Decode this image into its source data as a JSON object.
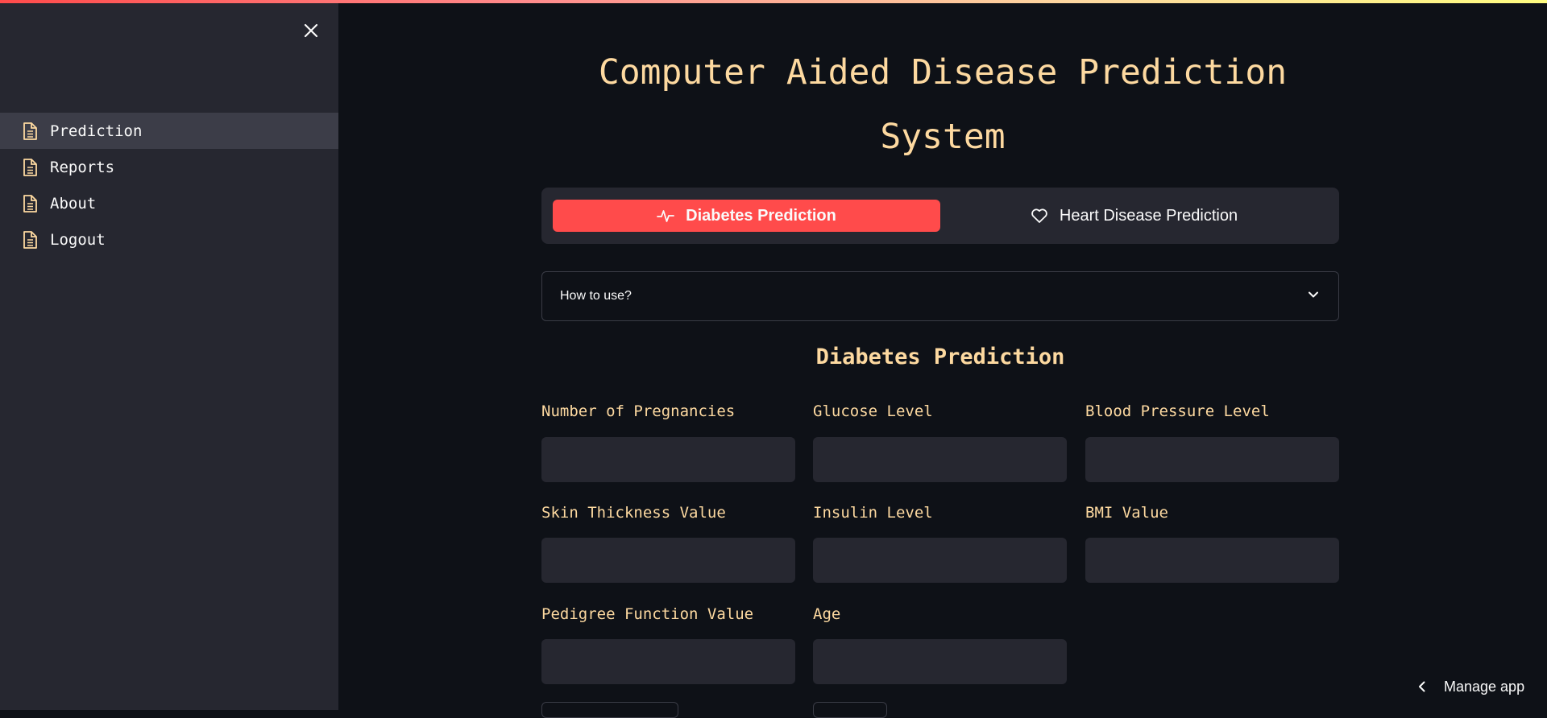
{
  "sidebar": {
    "close_icon": "close-icon",
    "items": [
      {
        "label": "Prediction",
        "icon": "document-icon",
        "active": true
      },
      {
        "label": "Reports",
        "icon": "document-icon",
        "active": false
      },
      {
        "label": "About",
        "icon": "document-icon",
        "active": false
      },
      {
        "label": "Logout",
        "icon": "document-icon",
        "active": false
      }
    ]
  },
  "main": {
    "title": "Computer Aided Disease Prediction System",
    "tabs": [
      {
        "label": "Diabetes Prediction",
        "icon": "activity-icon",
        "active": true
      },
      {
        "label": "Heart Disease Prediction",
        "icon": "heart-icon",
        "active": false
      }
    ],
    "expander": {
      "label": "How to use?",
      "icon": "chevron-down-icon"
    },
    "section_title": "Diabetes Prediction",
    "fields": [
      {
        "label": "Number of Pregnancies",
        "value": ""
      },
      {
        "label": "Glucose Level",
        "value": ""
      },
      {
        "label": "Blood Pressure Level",
        "value": ""
      },
      {
        "label": "Skin Thickness Value",
        "value": ""
      },
      {
        "label": "Insulin Level",
        "value": ""
      },
      {
        "label": "BMI Value",
        "value": ""
      },
      {
        "label": "Pedigree Function Value",
        "value": ""
      },
      {
        "label": "Age",
        "value": ""
      }
    ]
  },
  "footer": {
    "manage_app_label": "Manage app"
  },
  "colors": {
    "background": "#0e1117",
    "sidebar": "#262730",
    "accent": "#ff4b4b",
    "label_text": "#fdd9a0",
    "input_bg": "#262730"
  }
}
